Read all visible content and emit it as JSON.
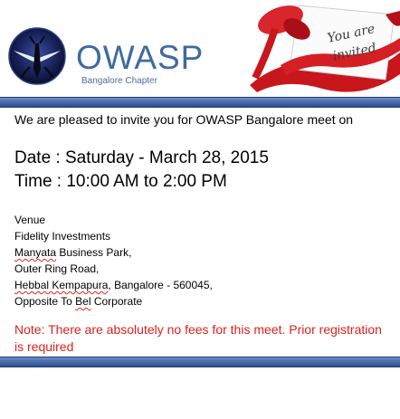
{
  "header": {
    "logo_text": "OWASP",
    "chapter_label": "Bangalore Chapter",
    "invite_card_text_line1": "You are",
    "invite_card_text_line2": "invited"
  },
  "intro_text": "We are pleased to invite you for OWASP Bangalore meet on",
  "date_line": "Date : Saturday - March 28, 2015",
  "time_line": "Time : 10:00 AM to 2:00 PM",
  "venue": {
    "heading": "Venue",
    "line1": "Fidelity Investments",
    "line2_word": "Manyata",
    "line2_rest": " Business Park,",
    "line3": "Outer Ring Road,",
    "line4_word": "Hebbal Kempapura",
    "line4_rest": ",  Bangalore - 560045,",
    "line5_a": "Opposite To ",
    "line5_word": "Bel",
    "line5_b": " Corporate"
  },
  "note_text": "Note: There are absolutely no fees for this meet. Prior registration is required",
  "colors": {
    "owasp_blue": "#3f6a9e",
    "rule_blue": "#4c6fb0",
    "note_red": "#e0201c",
    "ribbon_red": "#c8161d"
  }
}
